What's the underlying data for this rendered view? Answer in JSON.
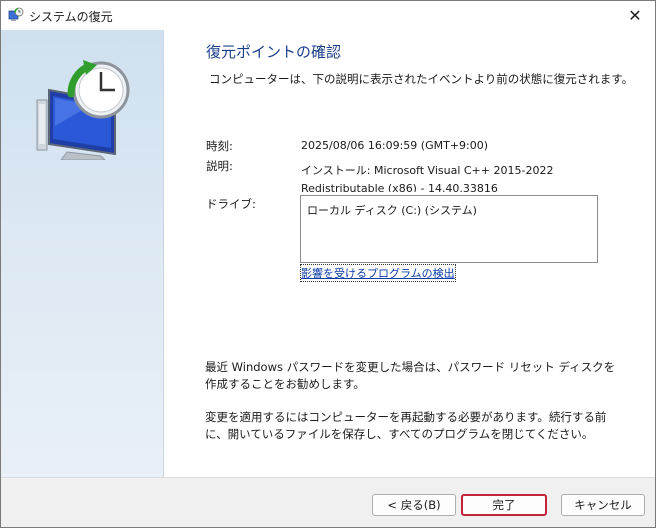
{
  "window": {
    "title": "システムの復元",
    "close_glyph": "✕"
  },
  "page": {
    "heading": "復元ポイントの確認",
    "intro": "コンピューターは、下の説明に表示されたイベントより前の状態に復元されます。",
    "time_label": "時刻:",
    "time_value": "2025/08/06 16:09:59 (GMT+9:00)",
    "description_label": "説明:",
    "description_value": "インストール: Microsoft Visual C++ 2015-2022 Redistributable (x86) - 14.40.33816",
    "drives_label": "ドライブ:",
    "drives": [
      "ローカル ディスク (C:) (システム)"
    ],
    "affected_link": "影響を受けるプログラムの検出",
    "password_note": "最近 Windows パスワードを変更した場合は、パスワード リセット ディスクを作成することをお勧めします。",
    "restart_note": "変更を適用するにはコンピューターを再起動する必要があります。続行する前に、開いているファイルを保存し、すべてのプログラムを閉じてください。"
  },
  "footer": {
    "back_label": "< 戻る(B)",
    "finish_label": "完了",
    "cancel_label": "キャンセル"
  },
  "icons": {
    "title_icon": "system-restore-icon",
    "hero_icon": "system-restore-monitor-clock-icon"
  },
  "colors": {
    "heading": "#1c3f8c",
    "link": "#0a3da8",
    "panel": "#d8e5f1",
    "focus_border": "#c2223c"
  }
}
